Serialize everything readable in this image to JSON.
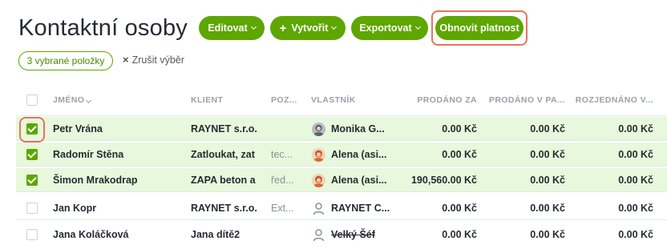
{
  "page_title": "Kontaktní osoby",
  "toolbar": {
    "edit_label": "Editovat",
    "create_label": "Vytvořit",
    "export_label": "Exportovat",
    "renew_label": "Obnovit platnost"
  },
  "selection": {
    "count_label": "3 vybrané položky",
    "clear_label": "Zrušit výběr"
  },
  "columns": {
    "name": "JMÉNO",
    "client": "KLIENT",
    "position": "POZ...",
    "owner": "VLASTNÍK",
    "sold_for": "PRODÁNO ZA",
    "sold_in": "PRODÁNO V PA...",
    "negotiated": "ROZJEDNÁNO V..."
  },
  "rows": [
    {
      "selected": true,
      "name": "Petr Vrána",
      "client": "RAYNET s.r.o.",
      "position": "",
      "owner": "Monika G...",
      "owner_avatar": "photo-woman-grey",
      "sold_for": "0.00 Kč",
      "sold_in": "0.00 Kč",
      "negotiated": "0.00 Kč"
    },
    {
      "selected": true,
      "name": "Radomír Stěna",
      "client": "Zatloukat, zat",
      "position": "tec...",
      "owner": "Alena (asi...",
      "owner_avatar": "photo-woman-orange",
      "sold_for": "0.00 Kč",
      "sold_in": "0.00 Kč",
      "negotiated": "0.00 Kč"
    },
    {
      "selected": true,
      "name": "Šimon Mrakodrap",
      "client": "ZAPA beton a",
      "position": "řed...",
      "owner": "Alena (asi...",
      "owner_avatar": "photo-woman-orange",
      "sold_for": "190,560.00 Kč",
      "sold_in": "0.00 Kč",
      "negotiated": "0.00 Kč"
    },
    {
      "selected": false,
      "name": "Jan Kopr",
      "client": "RAYNET s.r.o.",
      "position": "Ext...",
      "owner": "RAYNET C...",
      "owner_avatar": "user-outline-icon",
      "sold_for": "0.00 Kč",
      "sold_in": "0.00 Kč",
      "negotiated": "0.00 Kč"
    },
    {
      "selected": false,
      "name": "Jana Koláčková",
      "client": "Jana dítě2",
      "position": "",
      "owner": "Velký Šéf",
      "owner_avatar": "user-outline-icon",
      "owner_strike": true,
      "sold_for": "0.00 Kč",
      "sold_in": "0.00 Kč",
      "negotiated": "0.00 Kč"
    }
  ],
  "colors": {
    "accent": "#5ea600",
    "selected_row": "#e7f8dc",
    "highlight": "#e8735d"
  }
}
